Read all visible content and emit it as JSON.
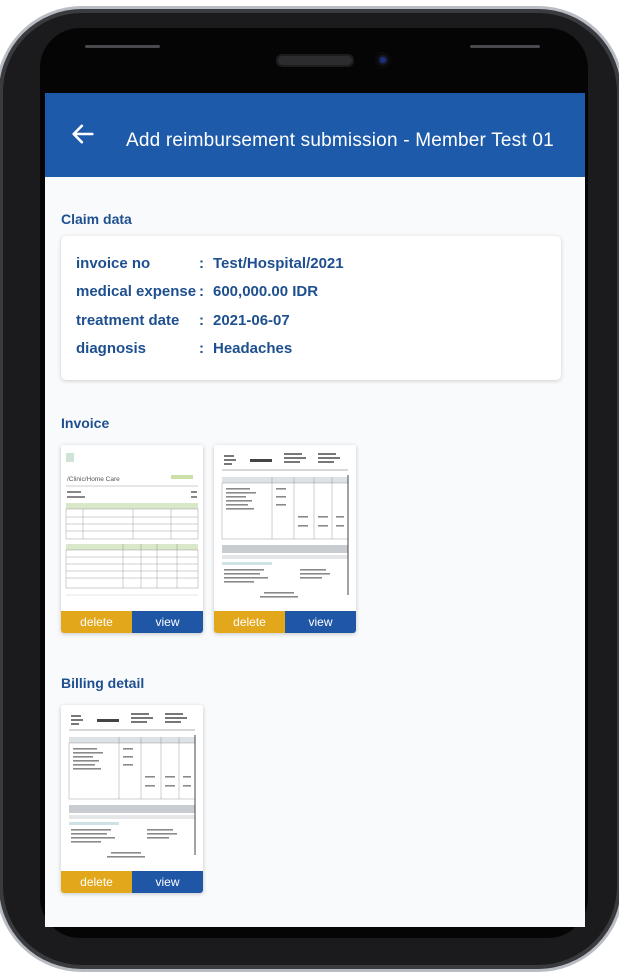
{
  "appbar": {
    "title": "Add reimbursement submission  - Member Test 01"
  },
  "claim": {
    "section_title": "Claim data",
    "fields": [
      {
        "label": "invoice no",
        "value": "Test/Hospital/2021"
      },
      {
        "label": "medical expense",
        "value": "600,000.00 IDR"
      },
      {
        "label": "treatment date",
        "value": "2021-06-07"
      },
      {
        "label": "diagnosis",
        "value": "Headaches"
      }
    ]
  },
  "invoice": {
    "section_title": "Invoice",
    "docs": [
      {
        "delete_label": "delete",
        "view_label": "view",
        "thumb_heading": "/Clinic/Home Care"
      },
      {
        "delete_label": "delete",
        "view_label": "view"
      }
    ]
  },
  "billing": {
    "section_title": "Billing detail",
    "docs": [
      {
        "delete_label": "delete",
        "view_label": "view"
      }
    ]
  },
  "colors": {
    "appbar": "#1e5aaa",
    "delete": "#e3a71c",
    "view": "#1f56a6",
    "text": "#1e4f8f"
  }
}
